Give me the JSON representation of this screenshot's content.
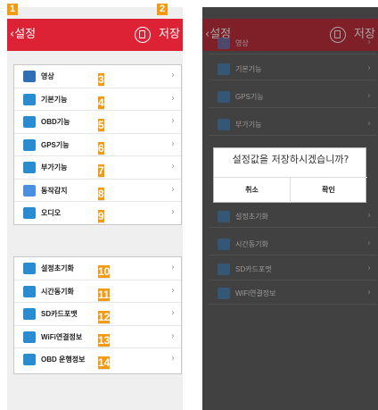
{
  "left": {
    "back_label": "설정",
    "save_label": "저장",
    "callouts": {
      "back": "1",
      "save": "2"
    },
    "group1": [
      {
        "label": "영상",
        "num": "3",
        "icon": "video-camera-icon",
        "color": "#2f6fb6"
      },
      {
        "label": "기본기능",
        "num": "4",
        "icon": "gear-icon",
        "color": "#2a8cd0"
      },
      {
        "label": "OBD기능",
        "num": "5",
        "icon": "car-icon",
        "color": "#2a8cd0"
      },
      {
        "label": "GPS기능",
        "num": "6",
        "icon": "gps-icon",
        "color": "#2a8cd0"
      },
      {
        "label": "부가기능",
        "num": "7",
        "icon": "settings-icon",
        "color": "#2a8cd0"
      },
      {
        "label": "동작감지",
        "num": "8",
        "icon": "motion-sensor-icon",
        "color": "#4a90e2"
      },
      {
        "label": "오디오",
        "num": "9",
        "icon": "speaker-icon",
        "color": "#2a8cd0"
      }
    ],
    "group2": [
      {
        "label": "설정초기화",
        "num": "10",
        "icon": "reset-icon",
        "color": "#2a8cd0"
      },
      {
        "label": "시간동기화",
        "num": "11",
        "icon": "clock-icon",
        "color": "#2a8cd0"
      },
      {
        "label": "SD카드포맷",
        "num": "12",
        "icon": "sd-card-icon",
        "color": "#2a8cd0"
      },
      {
        "label": "WiFi연결정보",
        "num": "13",
        "icon": "wifi-icon",
        "color": "#2a8cd0"
      },
      {
        "label": "OBD 운행정보",
        "num": "14",
        "icon": "car-icon",
        "color": "#2a8cd0"
      }
    ]
  },
  "right": {
    "back_label": "설정",
    "save_label": "저장",
    "rows": [
      {
        "label": "영상",
        "icon": "video-camera-icon"
      },
      {
        "label": "기본기능",
        "icon": "gear-icon"
      },
      {
        "label": "GPS기능",
        "icon": "gps-icon"
      },
      {
        "label": "부가기능",
        "icon": "settings-icon"
      },
      {
        "label": "설정초기화",
        "icon": "reset-icon"
      },
      {
        "label": "시간동기화",
        "icon": "clock-icon"
      },
      {
        "label": "SD카드포맷",
        "icon": "sd-card-icon"
      },
      {
        "label": "WiFi연결정보",
        "icon": "wifi-icon"
      }
    ],
    "dialog": {
      "message": "설정값을 저장하시겠습니까?",
      "cancel": "취소",
      "confirm": "확인"
    }
  },
  "colors": {
    "header": "#dd2236",
    "callout": "#f39a13"
  }
}
